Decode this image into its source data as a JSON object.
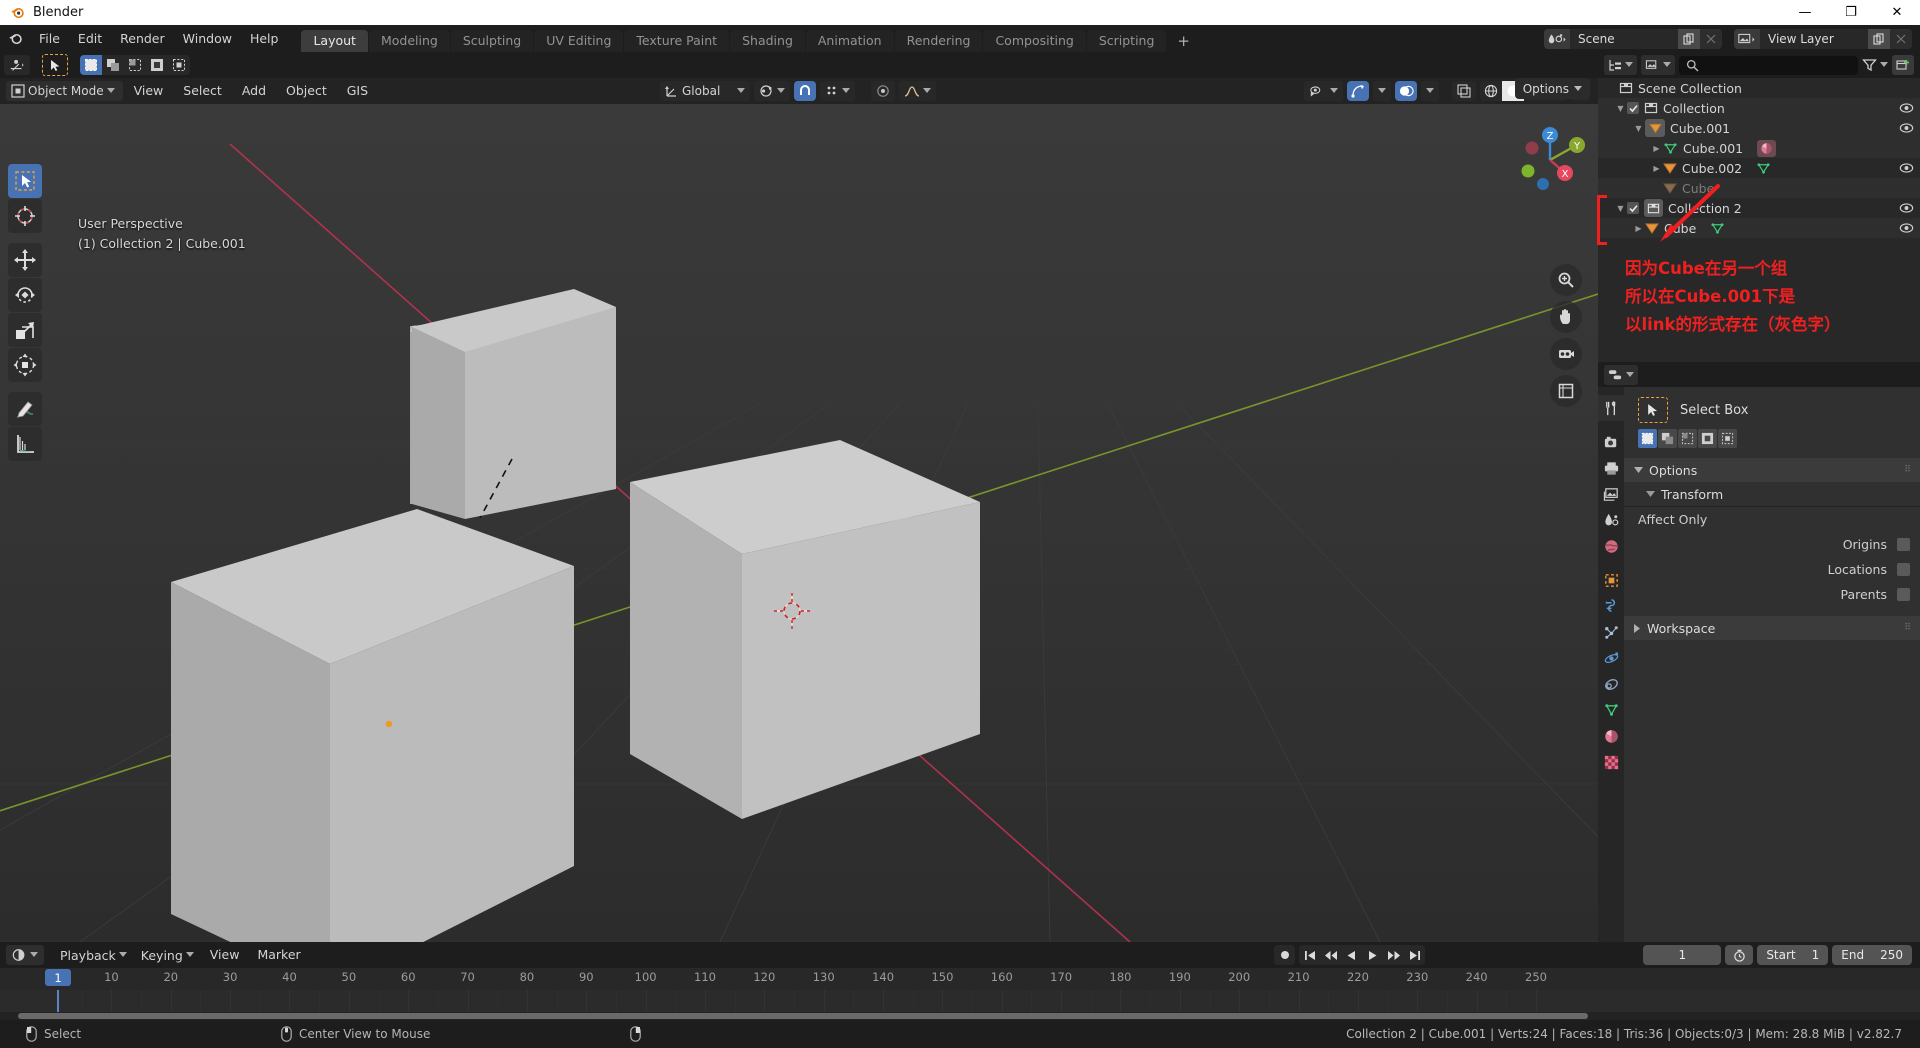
{
  "window": {
    "title": "Blender",
    "minimize": "—",
    "maximize": "❐",
    "close": "✕"
  },
  "topbar": {
    "menus": [
      "File",
      "Edit",
      "Render",
      "Window",
      "Help"
    ],
    "workspace_tabs": [
      {
        "label": "Layout",
        "active": true
      },
      {
        "label": "Modeling",
        "active": false
      },
      {
        "label": "Sculpting",
        "active": false
      },
      {
        "label": "UV Editing",
        "active": false
      },
      {
        "label": "Texture Paint",
        "active": false
      },
      {
        "label": "Shading",
        "active": false
      },
      {
        "label": "Animation",
        "active": false
      },
      {
        "label": "Rendering",
        "active": false
      },
      {
        "label": "Compositing",
        "active": false
      },
      {
        "label": "Scripting",
        "active": false
      }
    ],
    "add_workspace": "+",
    "scene_name": "Scene",
    "view_layer_name": "View Layer"
  },
  "viewport": {
    "toolbar_row": {
      "transform_orientation": "Global",
      "options_label": "Options"
    },
    "mode": "Object Mode",
    "menus": [
      "View",
      "Select",
      "Add",
      "Object",
      "GIS"
    ],
    "info_line1": "User Perspective",
    "info_line2": "(1) Collection 2 | Cube.001",
    "gizmo_axes": [
      "Z",
      "Y",
      "X"
    ],
    "left_tools": [
      "tweak-select-tool",
      "cursor-tool",
      "move-tool",
      "rotate-tool",
      "scale-tool",
      "transform-tool",
      "annotate-tool",
      "measure-tool"
    ],
    "nav_buttons": [
      "zoom-tool",
      "pan-tool",
      "camera-view-tool",
      "toggle-ortho-tool"
    ]
  },
  "outliner": {
    "search_placeholder": "",
    "rows": [
      {
        "label": "Scene Collection",
        "indent": 0,
        "icon": "collection-icon",
        "arrow": "",
        "checkbox": false,
        "eye": false,
        "dim": false
      },
      {
        "label": "Collection",
        "indent": 1,
        "icon": "collection-icon",
        "arrow": "down",
        "checkbox": true,
        "eye": true,
        "dim": false
      },
      {
        "label": "Cube.001",
        "indent": 2,
        "icon": "object-icon",
        "arrow": "down",
        "checkbox": false,
        "eye": true,
        "dim": false,
        "highlight": true
      },
      {
        "label": "Cube.001",
        "indent": 3,
        "icon": "mesh-icon",
        "arrow": "right",
        "checkbox": false,
        "eye": false,
        "dim": false,
        "material": true
      },
      {
        "label": "Cube.002",
        "indent": 3,
        "icon": "object-icon",
        "arrow": "right",
        "checkbox": false,
        "eye": true,
        "dim": false,
        "mesh_badge": true
      },
      {
        "label": "Cube",
        "indent": 3,
        "icon": "object-icon-dim",
        "arrow": "",
        "checkbox": false,
        "eye": false,
        "dim": true,
        "linked": true
      },
      {
        "label": "Collection 2",
        "indent": 1,
        "icon": "collection-icon",
        "arrow": "down",
        "checkbox": true,
        "eye": true,
        "dim": false,
        "active": true
      },
      {
        "label": "Cube",
        "indent": 2,
        "icon": "object-icon",
        "arrow": "right",
        "checkbox": false,
        "eye": true,
        "dim": false,
        "mesh_badge": true
      }
    ]
  },
  "annotation": {
    "line1": "因为Cube在另一个组",
    "line2": "所以在Cube.001下是",
    "line3": "以link的形式存在（灰色字）",
    "color": "#f02020"
  },
  "properties": {
    "active_tool_name": "Select Box",
    "panels": [
      {
        "label": "Options",
        "expanded": true
      },
      {
        "label": "Transform",
        "expanded": true,
        "sub": true
      },
      {
        "label": "Workspace",
        "expanded": false
      }
    ],
    "affect_only_label": "Affect Only",
    "affect_only_items": [
      {
        "label": "Origins",
        "checked": false
      },
      {
        "label": "Locations",
        "checked": false
      },
      {
        "label": "Parents",
        "checked": false
      }
    ],
    "tabs": [
      "tool-tab",
      "render-tab",
      "output-tab",
      "view-layer-tab",
      "scene-tab",
      "world-tab",
      "object-tab",
      "modifiers-tab",
      "particles-tab",
      "physics-tab",
      "constraints-tab",
      "data-tab",
      "material-tab",
      "texture-tab"
    ]
  },
  "timeline": {
    "menus": [
      "View",
      "Marker"
    ],
    "dropdowns": [
      "Playback",
      "Keying"
    ],
    "current_frame": "1",
    "start_label": "Start",
    "start_value": "1",
    "end_label": "End",
    "end_value": "250",
    "ticks": [
      1,
      10,
      20,
      30,
      40,
      50,
      60,
      70,
      80,
      90,
      100,
      110,
      120,
      130,
      140,
      150,
      160,
      170,
      180,
      190,
      200,
      210,
      220,
      230,
      240,
      250
    ],
    "playhead_frame": 1,
    "transport": [
      "record",
      "jump-start",
      "prev-keyframe",
      "play-reverse",
      "play",
      "next-keyframe",
      "jump-end"
    ]
  },
  "statusbar": {
    "mouse_hints": [
      {
        "icon": "mouse-left-icon",
        "label": "Select"
      },
      {
        "icon": "mouse-middle-icon",
        "label": "Center View to Mouse"
      },
      {
        "icon": "mouse-right-icon",
        "label": ""
      }
    ],
    "scene_stats": "Collection 2 | Cube.001 | Verts:24 | Faces:18 | Tris:36 | Objects:0/3 | Mem: 28.8 MiB | v2.82.7"
  },
  "colors": {
    "accent_blue": "#4772b3",
    "panel_bg": "#303030",
    "header_bg": "#1d1d1d",
    "outliner_bg": "#282828",
    "annotation_red": "#f02020",
    "axis_x_red": "#bb3352",
    "axis_y_green": "#8ba82e"
  }
}
